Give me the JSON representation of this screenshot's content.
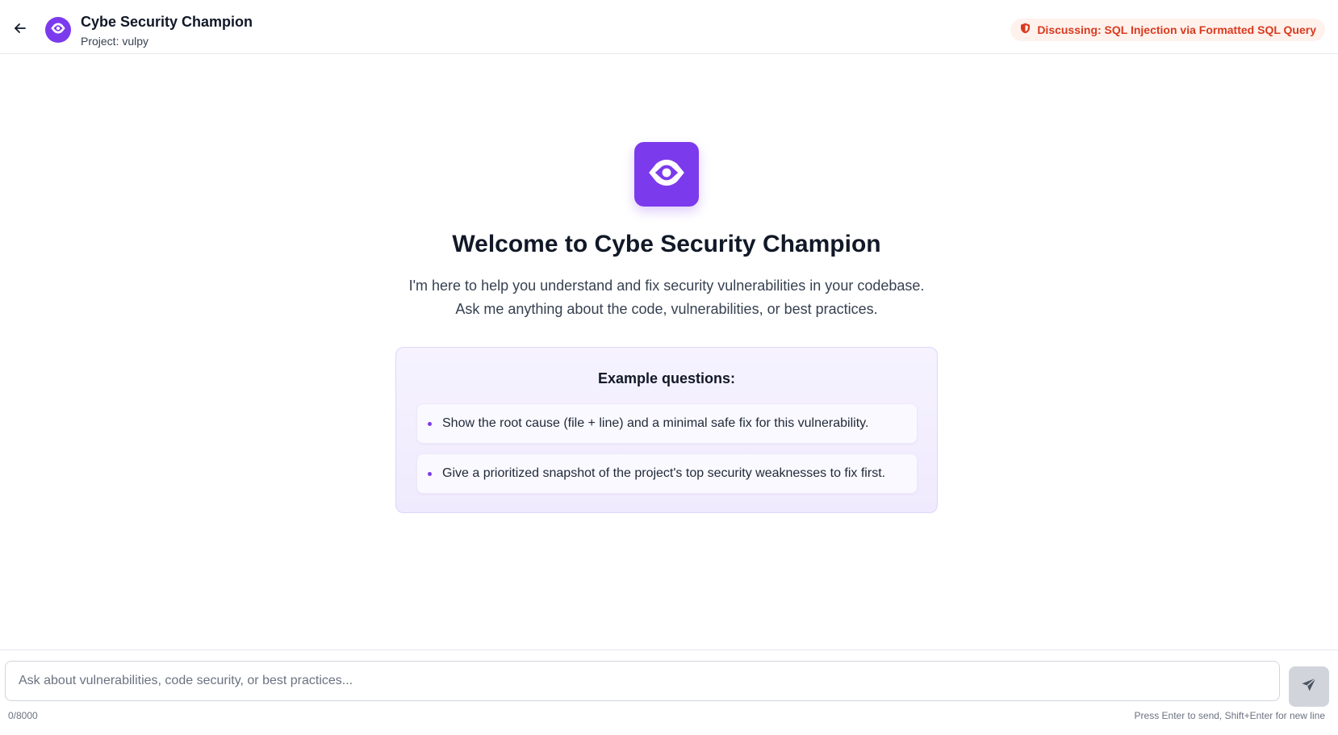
{
  "header": {
    "title": "Cybe Security Champion",
    "subtitle": "Project: vulpy",
    "back_icon": "arrow-left-icon",
    "avatar_icon": "eye-logo-icon",
    "badge": {
      "icon": "shield-icon",
      "text": "Discussing: SQL Injection via Formatted SQL Query",
      "color": "#d93a1e",
      "background": "#fff1ec"
    }
  },
  "welcome": {
    "icon": "eye-logo-icon",
    "title": "Welcome to Cybe Security Champion",
    "description_line1": "I'm here to help you understand and fix security vulnerabilities in your codebase.",
    "description_line2": "Ask me anything about the code, vulnerabilities, or best practices."
  },
  "examples": {
    "title": "Example questions:",
    "items": [
      {
        "text": "Show the root cause (file + line) and a minimal safe fix for this vulnerability."
      },
      {
        "text": "Give a prioritized snapshot of the project's top security weaknesses to fix first."
      }
    ]
  },
  "composer": {
    "placeholder": "Ask about vulnerabilities, code security, or best practices...",
    "value": "",
    "char_count": "0/8000",
    "hint": "Press Enter to send, Shift+Enter for new line",
    "send_icon": "paper-plane-icon"
  },
  "colors": {
    "accent": "#7c3aed",
    "border": "#e5e7eb",
    "send_disabled": "#d1d5db"
  }
}
